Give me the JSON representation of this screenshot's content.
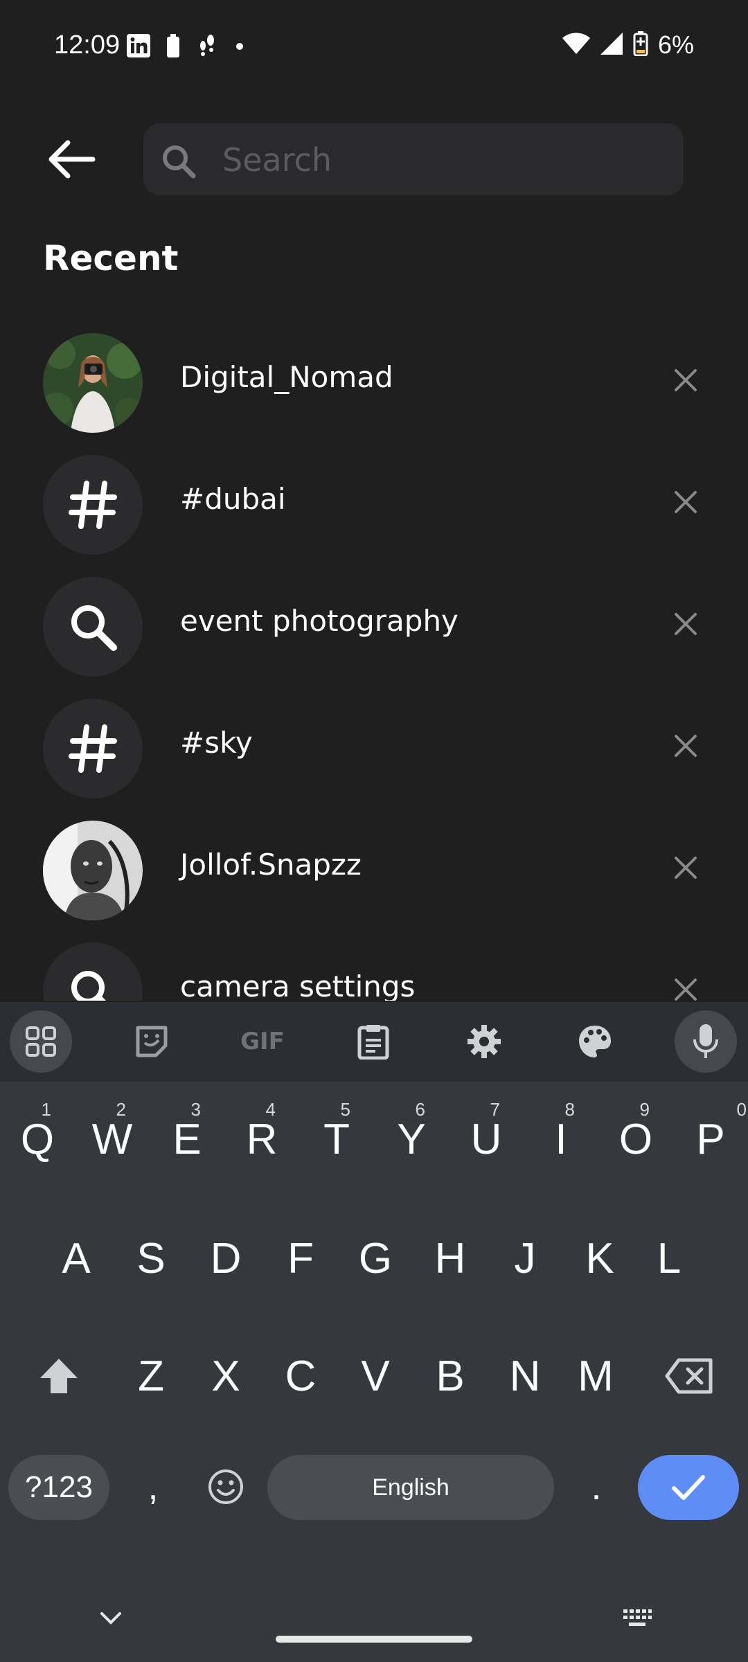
{
  "status_bar": {
    "time": "12:09",
    "battery": "6%"
  },
  "search": {
    "placeholder": "Search",
    "value": ""
  },
  "recent": {
    "title": "Recent",
    "items": [
      {
        "label": "Digital_Nomad",
        "kind": "profile",
        "icon": "profile-photo"
      },
      {
        "label": "#dubai",
        "kind": "hashtag",
        "icon": "hashtag-icon"
      },
      {
        "label": "event photography",
        "kind": "search",
        "icon": "search-icon"
      },
      {
        "label": "#sky",
        "kind": "hashtag",
        "icon": "hashtag-icon"
      },
      {
        "label": "Jollof.Snapzz",
        "kind": "profile",
        "icon": "profile-photo"
      },
      {
        "label": "camera settings",
        "kind": "search",
        "icon": "search-icon"
      }
    ]
  },
  "keyboard": {
    "toolbar": {
      "gif_label": "GIF"
    },
    "row1": [
      {
        "key": "Q",
        "hint": "1"
      },
      {
        "key": "W",
        "hint": "2"
      },
      {
        "key": "E",
        "hint": "3"
      },
      {
        "key": "R",
        "hint": "4"
      },
      {
        "key": "T",
        "hint": "5"
      },
      {
        "key": "Y",
        "hint": "6"
      },
      {
        "key": "U",
        "hint": "7"
      },
      {
        "key": "I",
        "hint": "8"
      },
      {
        "key": "O",
        "hint": "9"
      },
      {
        "key": "P",
        "hint": "0"
      }
    ],
    "row2": [
      "A",
      "S",
      "D",
      "F",
      "G",
      "H",
      "J",
      "K",
      "L"
    ],
    "row3": [
      "Z",
      "X",
      "C",
      "V",
      "B",
      "N",
      "M"
    ],
    "symbols_label": "?123",
    "comma": ",",
    "space_label": "English",
    "period": ".",
    "accent_color": "#5e8ef5"
  }
}
